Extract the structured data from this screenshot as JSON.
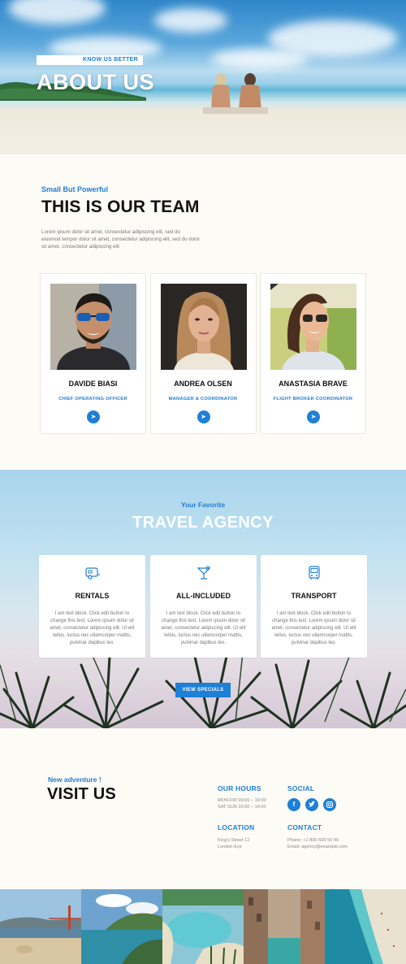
{
  "hero": {
    "tag": "KNOW US BETTER",
    "title": "ABOUT US"
  },
  "team": {
    "subtitle": "Small But Powerful",
    "title": "THIS IS OUR TEAM",
    "description": "Lorem ipsum dolor sit amet, consectetur adipiscing elit, sed do eiusmod tempor dolor sit amet, consectetur adipiscing elit, sed do dolor sit amet, consectetur adipiscing elit",
    "members": [
      {
        "name": "DAVIDE BIASI",
        "role": "CHIEF OPERATING OFFICER",
        "icon": "telegram-icon"
      },
      {
        "name": "ANDREA OLSEN",
        "role": "MANAGER & COORDINATOR",
        "icon": "telegram-icon"
      },
      {
        "name": "ANASTASIA BRAVE",
        "role": "FLIGHT BROKER COORDINATOR",
        "icon": "telegram-icon"
      }
    ]
  },
  "agency": {
    "subtitle": "Your Favorite",
    "title": "TRAVEL AGENCY",
    "services": [
      {
        "title": "RENTALS",
        "icon": "caravan-icon",
        "text": "I am text block. Click edit button to change this text. Lorem ipsum dolor sit amet, consectetur adipiscing elit. Ut elit tellus, luctus nec ullamcorper mattis, pulvinar dapibus leo."
      },
      {
        "title": "ALL-INCLUDED",
        "icon": "cocktail-icon",
        "text": "I am text block. Click edit button to change this text. Lorem ipsum dolor sit amet, consectetur adipiscing elit. Ut elit tellus, luctus nec ullamcorper mattis, pulvinar dapibus leo."
      },
      {
        "title": "TRANSPORT",
        "icon": "bus-icon",
        "text": "I am text block. Click edit button to change this text. Lorem ipsum dolor sit amet, consectetur adipiscing elit. Ut elit tellus, luctus nec ullamcorper mattis, pulvinar dapibus leo."
      }
    ],
    "button": "VIEW SPECIALS"
  },
  "visit": {
    "subtitle": "New adventure !",
    "title": "VISIT US",
    "hours": {
      "heading": "OUR HOURS",
      "lines": [
        "MON-FRI 09:00 – 19:00",
        "SAT-SUN 10:00 – 14:00"
      ]
    },
    "social": {
      "heading": "SOCIAL",
      "icons": [
        "facebook-icon",
        "twitter-icon",
        "instagram-icon"
      ]
    },
    "location": {
      "heading": "LOCATION",
      "lines": [
        "King's Street 12",
        "London Eye"
      ]
    },
    "contact": {
      "heading": "CONTACT",
      "lines": [
        "Phone: +1 800 600 50 40",
        "Email: agency@example.com"
      ]
    }
  },
  "colors": {
    "accent": "#1e7fd6",
    "background": "#fdfbf6",
    "heading": "#111111"
  }
}
